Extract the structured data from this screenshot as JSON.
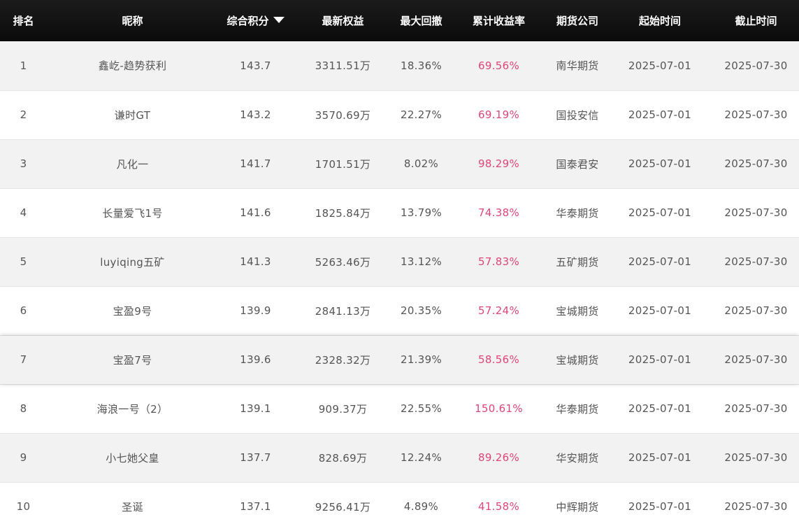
{
  "headers": {
    "rank": "排名",
    "nickname": "昵称",
    "score": "综合积分",
    "equity": "最新权益",
    "drawdown": "最大回撤",
    "return_rate": "累计收益率",
    "company": "期货公司",
    "start": "起始时间",
    "end": "截止时间"
  },
  "sort_icon": "caret-down-icon",
  "colors": {
    "header_bg": "#111111",
    "return_rate": "#e0457b",
    "row_alt": "#f2f2f2"
  },
  "rows": [
    {
      "rank": "1",
      "nickname": "鑫屹-趋势获利",
      "score": "143.7",
      "equity": "3311.51万",
      "drawdown": "18.36%",
      "return_rate": "69.56%",
      "company": "南华期货",
      "start": "2025-07-01",
      "end": "2025-07-30"
    },
    {
      "rank": "2",
      "nickname": "谦时GT",
      "score": "143.2",
      "equity": "3570.69万",
      "drawdown": "22.27%",
      "return_rate": "69.19%",
      "company": "国投安信",
      "start": "2025-07-01",
      "end": "2025-07-30"
    },
    {
      "rank": "3",
      "nickname": "凡化一",
      "score": "141.7",
      "equity": "1701.51万",
      "drawdown": "8.02%",
      "return_rate": "98.29%",
      "company": "国泰君安",
      "start": "2025-07-01",
      "end": "2025-07-30"
    },
    {
      "rank": "4",
      "nickname": "长量爱飞1号",
      "score": "141.6",
      "equity": "1825.84万",
      "drawdown": "13.79%",
      "return_rate": "74.38%",
      "company": "华泰期货",
      "start": "2025-07-01",
      "end": "2025-07-30"
    },
    {
      "rank": "5",
      "nickname": "luyiqing五矿",
      "score": "141.3",
      "equity": "5263.46万",
      "drawdown": "13.12%",
      "return_rate": "57.83%",
      "company": "五矿期货",
      "start": "2025-07-01",
      "end": "2025-07-30"
    },
    {
      "rank": "6",
      "nickname": "宝盈9号",
      "score": "139.9",
      "equity": "2841.13万",
      "drawdown": "20.35%",
      "return_rate": "57.24%",
      "company": "宝城期货",
      "start": "2025-07-01",
      "end": "2025-07-30"
    },
    {
      "rank": "7",
      "nickname": "宝盈7号",
      "score": "139.6",
      "equity": "2328.32万",
      "drawdown": "21.39%",
      "return_rate": "58.56%",
      "company": "宝城期货",
      "start": "2025-07-01",
      "end": "2025-07-30"
    },
    {
      "rank": "8",
      "nickname": "海浪一号（2）",
      "score": "139.1",
      "equity": "909.37万",
      "drawdown": "22.55%",
      "return_rate": "150.61%",
      "company": "华泰期货",
      "start": "2025-07-01",
      "end": "2025-07-30"
    },
    {
      "rank": "9",
      "nickname": "小七她父皇",
      "score": "137.7",
      "equity": "828.69万",
      "drawdown": "12.24%",
      "return_rate": "89.26%",
      "company": "华安期货",
      "start": "2025-07-01",
      "end": "2025-07-30"
    },
    {
      "rank": "10",
      "nickname": "圣诞",
      "score": "137.1",
      "equity": "9256.41万",
      "drawdown": "4.89%",
      "return_rate": "41.58%",
      "company": "中辉期货",
      "start": "2025-07-01",
      "end": "2025-07-30"
    }
  ]
}
